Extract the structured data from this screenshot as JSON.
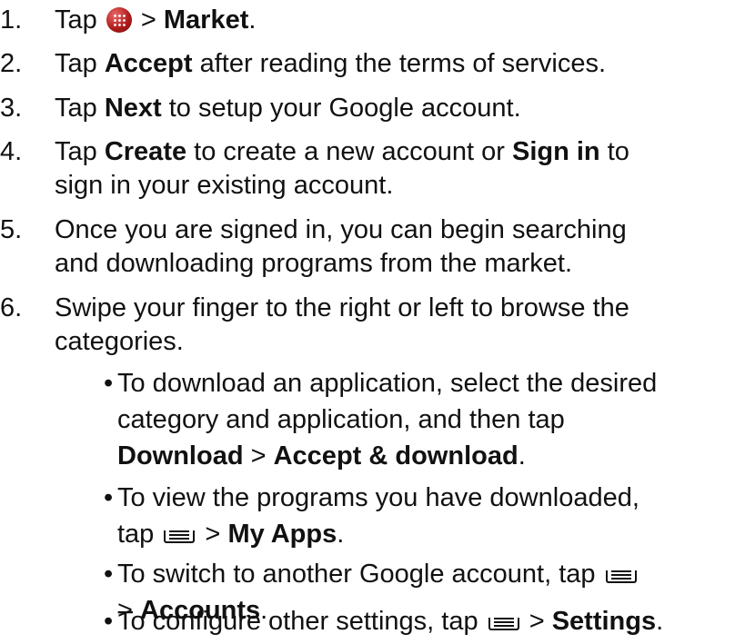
{
  "steps": [
    {
      "num": "1.",
      "parts": [
        "Tap ",
        " > ",
        "Market",
        "."
      ]
    },
    {
      "num": "2.",
      "parts": [
        "Tap ",
        "Accept",
        " after reading the terms of services."
      ]
    },
    {
      "num": "3.",
      "parts": [
        "Tap ",
        "Next",
        " to setup your Google account."
      ]
    },
    {
      "num": "4.",
      "parts": [
        "Tap ",
        "Create",
        " to create a new account or ",
        "Sign in",
        " to",
        "sign in your existing account."
      ]
    },
    {
      "num": "5.",
      "parts": [
        "Once you are signed in, you can begin searching",
        "and downloading programs from the market."
      ]
    },
    {
      "num": "6.",
      "parts": [
        "Swipe your finger to the right or left to browse the",
        "categories."
      ]
    }
  ],
  "bullets": [
    {
      "dot": "•",
      "parts": [
        "To download an application, select the desired",
        "category and application, and then tap",
        "Download",
        " > ",
        "Accept & download",
        "."
      ]
    },
    {
      "dot": "•",
      "parts": [
        "To view the programs you have downloaded,",
        "tap ",
        " > ",
        "My Apps",
        "."
      ]
    },
    {
      "dot": "•",
      "parts": [
        "To switch to another Google account, tap ",
        "> ",
        "Accounts",
        "."
      ]
    },
    {
      "dot": "•",
      "parts": [
        "To configure other settings, tap ",
        " > ",
        "Settings",
        "."
      ]
    }
  ],
  "icons": {
    "app_drawer": "app-drawer-icon",
    "menu": "menu-icon"
  }
}
